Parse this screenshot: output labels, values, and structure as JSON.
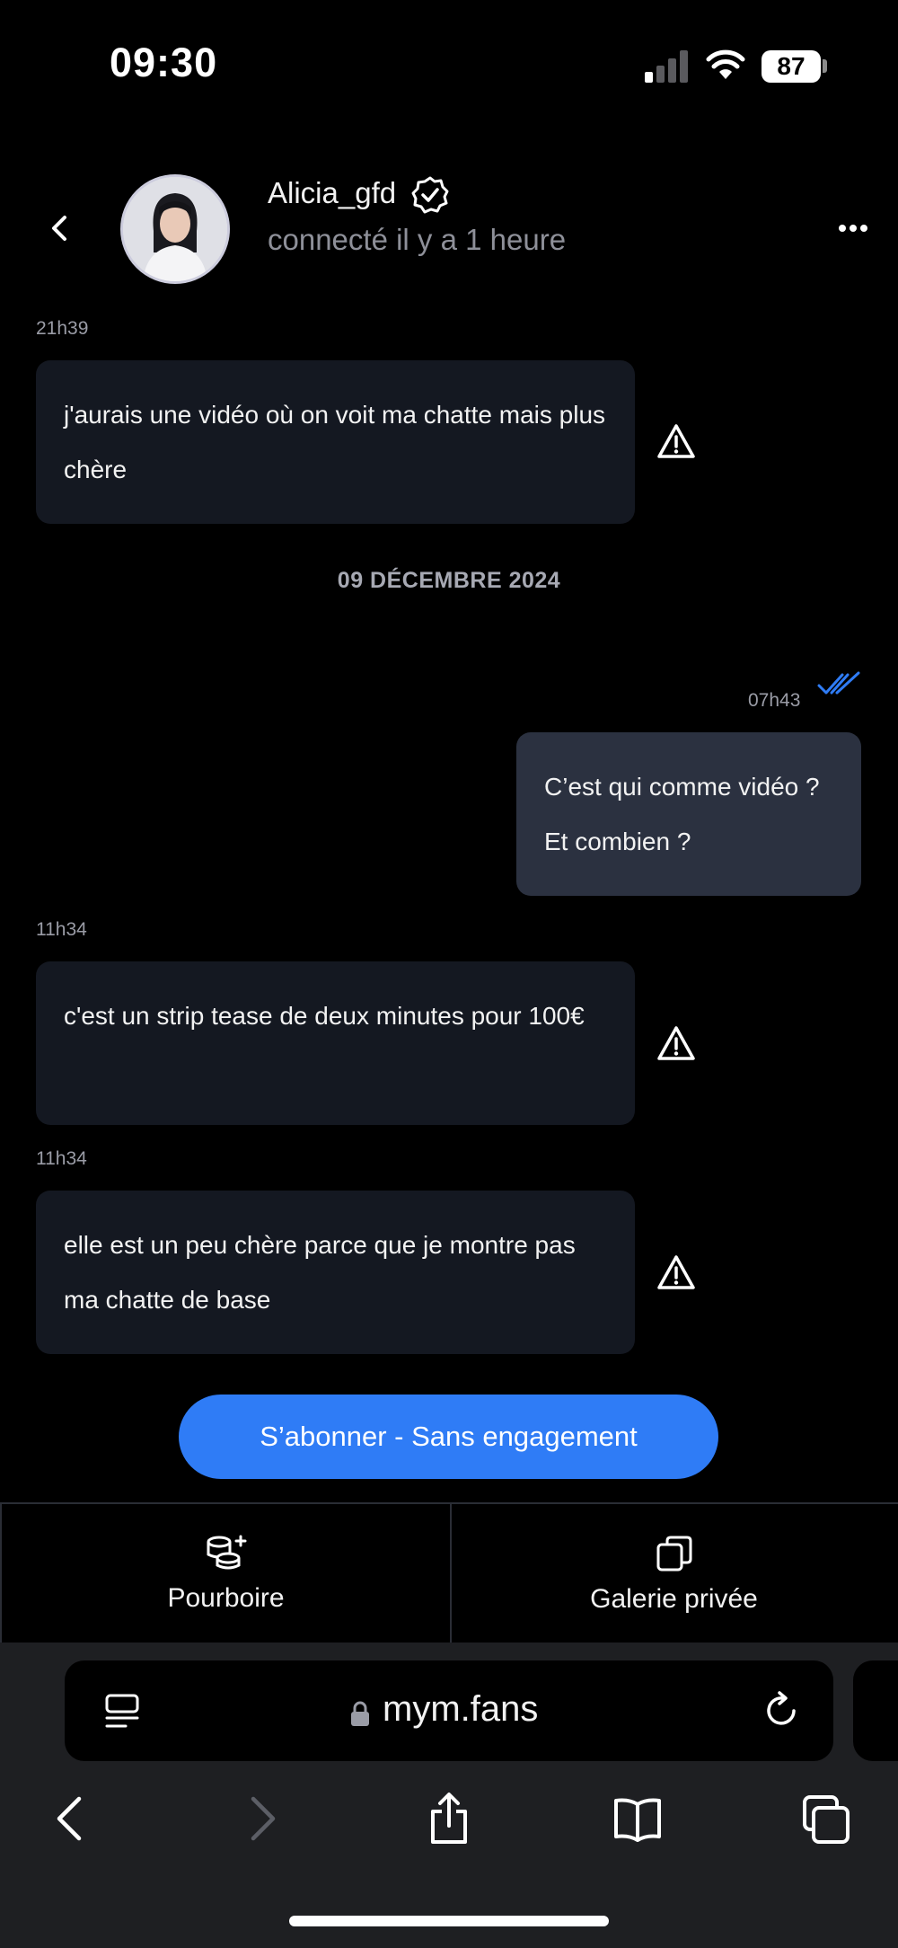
{
  "status_bar": {
    "time": "09:30",
    "battery": "87"
  },
  "header": {
    "back_icon": "chevron-left-icon",
    "username": "Alicia_gfd",
    "verified_icon": "verified-badge-icon",
    "presence": "connecté il y a 1 heure",
    "more_icon": "ellipsis-icon"
  },
  "messages": [
    {
      "time": "21h39",
      "text": "j'aurais une vidéo où on voit ma chatte mais plus chère",
      "direction": "in"
    },
    {
      "time": "07h43",
      "text": "C’est qui comme vidéo ? Et combien ?",
      "direction": "out",
      "read": true
    },
    {
      "time": "11h34",
      "text": "c'est un strip tease de deux minutes pour 100€",
      "direction": "in"
    },
    {
      "time": "11h34",
      "text": "elle est un peu chère parce que je montre pas ma chatte de base",
      "direction": "in"
    }
  ],
  "date_separator": "09 DÉCEMBRE 2024",
  "subscribe_button": "S’abonner - Sans engagement",
  "tabs": [
    {
      "label": "Pourboire",
      "icon": "tip-coins-icon"
    },
    {
      "label": "Galerie privée",
      "icon": "gallery-copy-icon"
    }
  ],
  "browser": {
    "url": "mym.fans",
    "icons": [
      "reader-icon",
      "lock-icon",
      "reload-icon",
      "back-icon",
      "forward-icon",
      "share-icon",
      "bookmarks-icon",
      "tabs-icon"
    ]
  },
  "colors": {
    "accent": "#2f7cf6",
    "bubble_in": "#141821",
    "bubble_out": "#2b3140",
    "warning": "#ffffff"
  }
}
